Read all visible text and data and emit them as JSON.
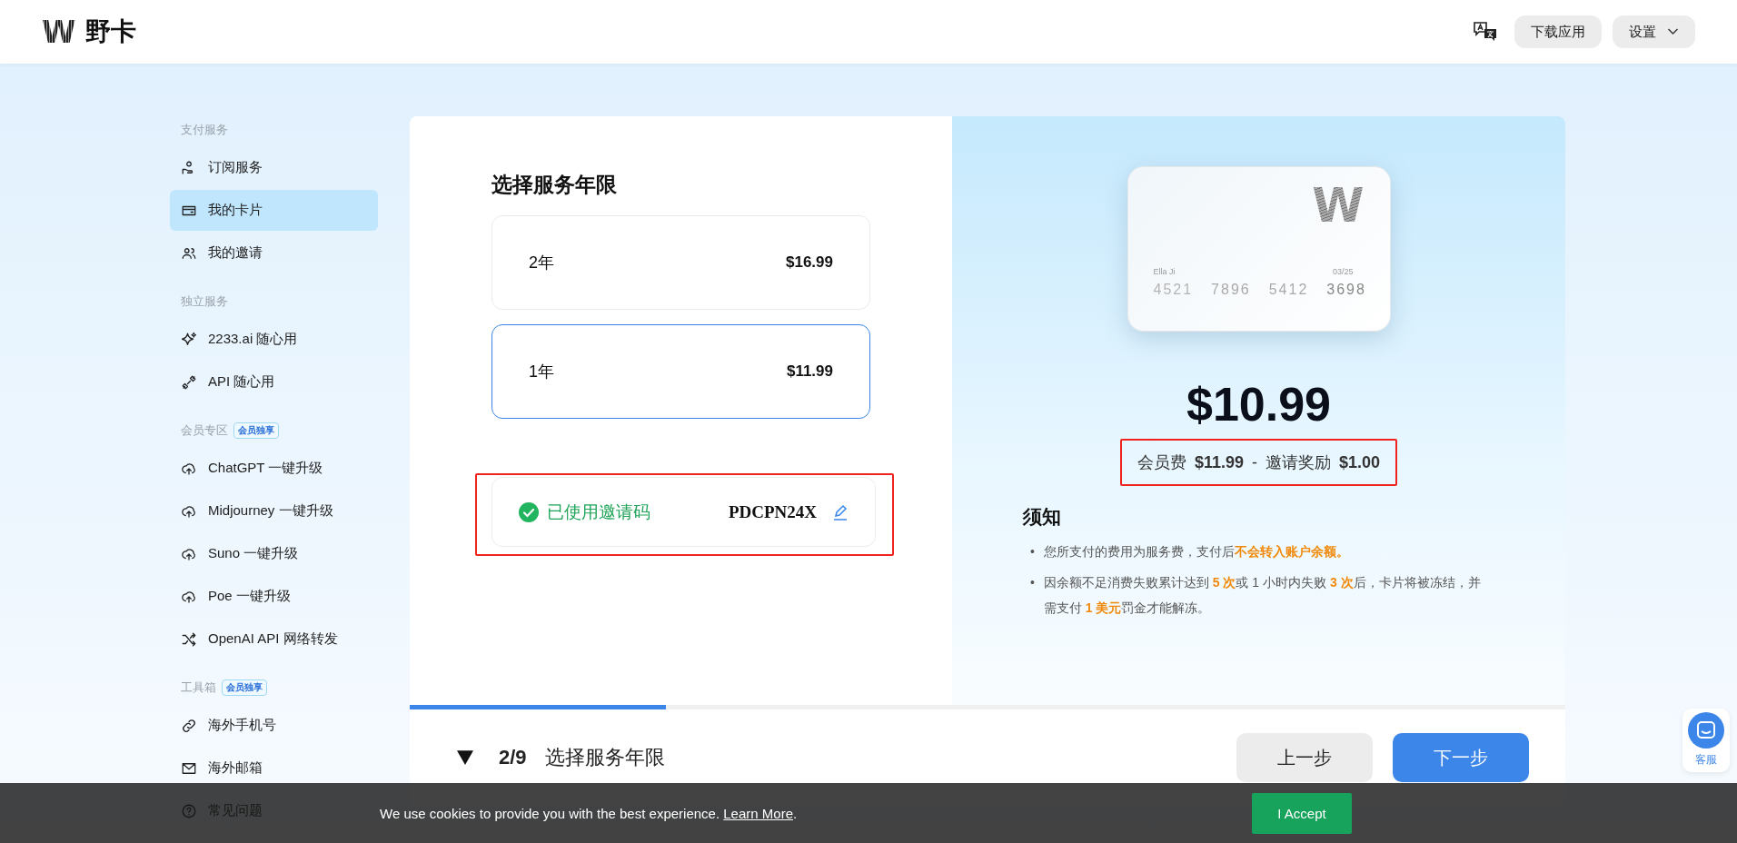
{
  "header": {
    "logo_mark": "W",
    "brand": "野卡",
    "download_button": "下载应用",
    "settings_button": "设置"
  },
  "sidebar": {
    "sections": [
      {
        "heading": "支付服务",
        "items": [
          {
            "label": "订阅服务",
            "selected": false
          },
          {
            "label": "我的卡片",
            "selected": true
          },
          {
            "label": "我的邀请",
            "selected": false
          }
        ]
      },
      {
        "heading": "独立服务",
        "items": [
          {
            "label": "2233.ai 随心用",
            "selected": false
          },
          {
            "label": "API 随心用",
            "selected": false
          }
        ]
      },
      {
        "heading": "会员专区",
        "badge": "会员独享",
        "items": [
          {
            "label": "ChatGPT 一键升级",
            "selected": false
          },
          {
            "label": "Midjourney 一键升级",
            "selected": false
          },
          {
            "label": "Suno 一键升级",
            "selected": false
          },
          {
            "label": "Poe 一键升级",
            "selected": false
          },
          {
            "label": "OpenAI API 网络转发",
            "selected": false
          }
        ]
      },
      {
        "heading": "工具箱",
        "badge": "会员独享",
        "items": [
          {
            "label": "海外手机号",
            "selected": false
          },
          {
            "label": "海外邮箱",
            "selected": false
          },
          {
            "label": "常见问题",
            "selected": false
          }
        ]
      }
    ]
  },
  "plan": {
    "title": "选择服务年限",
    "options": [
      {
        "label": "2年",
        "price": "$16.99",
        "selected": false
      },
      {
        "label": "1年",
        "price": "$11.99",
        "selected": true
      }
    ],
    "invite": {
      "status": "已使用邀请码",
      "code": "PDCPN24X"
    }
  },
  "card": {
    "logo_mark": "W",
    "holder": "Ella Ji",
    "expiry": "03/25",
    "number": [
      "4521",
      "7896",
      "5412",
      "3698"
    ]
  },
  "price": {
    "total": "$10.99",
    "breakdown": "会员费 **$11.99** - 邀请奖励 **$1.00**"
  },
  "notice": {
    "title": "须知",
    "bullet": "•",
    "items": [
      [
        {
          "text": "您所支付的费用为服务费，支付后",
          "emphasis": false
        },
        {
          "text": "不会转入账户余额。",
          "emphasis": true
        }
      ],
      [
        {
          "text": "因余额不足消费失败累计达到 ",
          "emphasis": false
        },
        {
          "text": "5 次",
          "emphasis": true
        },
        {
          "text": "或 1 小时内失败 ",
          "emphasis": false
        },
        {
          "text": "3 次",
          "emphasis": true
        },
        {
          "text": "后，卡片将被冻结，并需支付 ",
          "emphasis": false
        },
        {
          "text": "1 美元",
          "emphasis": true
        },
        {
          "text": "罚金才能解冻。",
          "emphasis": false
        }
      ]
    ]
  },
  "progress": {
    "level": 0.222
  },
  "step": {
    "counter": "2/9",
    "title": "选择服务年限",
    "back_button": "上一步",
    "next_button": "下一步"
  },
  "support": {
    "label": "客服"
  },
  "cookie_bar": {
    "message": "We use cookies to provide you with the best experience. ",
    "link": "Learn More",
    "end": ".",
    "accept_button": "I Accept"
  }
}
